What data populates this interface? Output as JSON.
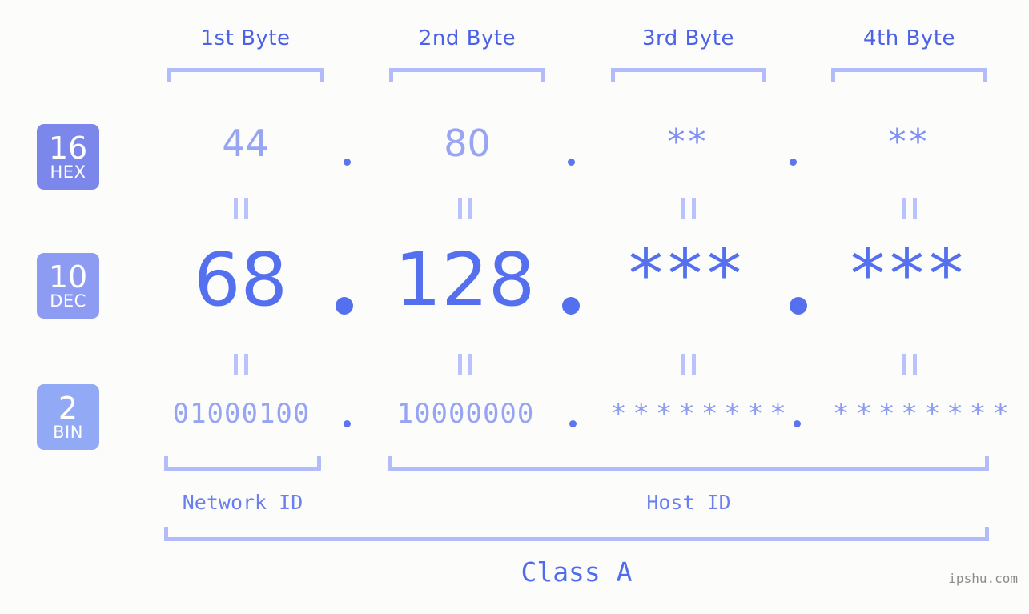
{
  "meta": {
    "watermark": "ipshu.com",
    "background": "#fcfdfa",
    "accent_strong": "#5470ee",
    "accent_mid": "#8d9bf2",
    "accent_light": "#b3bcfb"
  },
  "byte_headers": [
    {
      "label": "1st Byte"
    },
    {
      "label": "2nd Byte"
    },
    {
      "label": "3rd Byte"
    },
    {
      "label": "4th Byte"
    }
  ],
  "bases": [
    {
      "num": "16",
      "name": "HEX",
      "color": "#7b87ea"
    },
    {
      "num": "10",
      "name": "DEC",
      "color": "#8d9bf2"
    },
    {
      "num": "2",
      "name": "BIN",
      "color": "#92a9f5"
    }
  ],
  "rows": {
    "hex": {
      "values": [
        "44",
        "80",
        "**",
        "**"
      ],
      "separators": [
        ".",
        ".",
        "."
      ]
    },
    "dec": {
      "values": [
        "68",
        "128",
        "***",
        "***"
      ],
      "separators": [
        ".",
        ".",
        "."
      ]
    },
    "bin": {
      "values": [
        "01000100",
        "10000000",
        "********",
        "********"
      ],
      "separators": [
        ".",
        ".",
        "."
      ]
    }
  },
  "equals_marks": {
    "symbol": "=",
    "count_per_row": 4
  },
  "footer": {
    "network_id": "Network ID",
    "host_id": "Host ID",
    "class": "Class A"
  }
}
